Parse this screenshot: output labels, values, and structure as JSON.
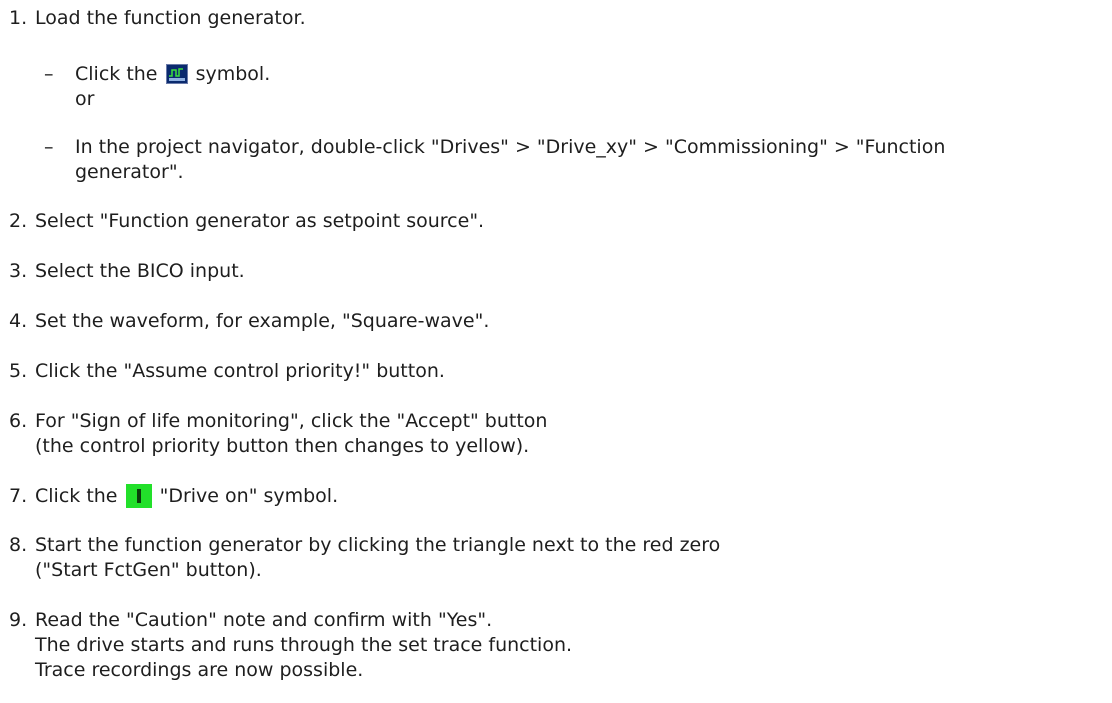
{
  "steps": [
    {
      "num": "1.",
      "text": "Load the function generator."
    },
    {
      "num": "2.",
      "text": "Select \"Function generator as setpoint source\"."
    },
    {
      "num": "3.",
      "text": "Select the BICO input."
    },
    {
      "num": "4.",
      "text": "Set the waveform, for example, \"Square-wave\"."
    },
    {
      "num": "5.",
      "text": "Click the \"Assume control priority!\" button."
    },
    {
      "num": "6.",
      "text": "For \"Sign of life monitoring\", click the \"Accept\" button",
      "text2": "(the control priority button then changes to yellow)."
    },
    {
      "num": "7.",
      "pre": "Click the",
      "post": "\"Drive on\" symbol.",
      "icon": "drive-on-icon"
    },
    {
      "num": "8.",
      "text": "Start the function generator by clicking the triangle next to the red zero",
      "text2": "(\"Start FctGen\" button)."
    },
    {
      "num": "9.",
      "text": "Read the \"Caution\" note and confirm with \"Yes\".",
      "text2": "The drive starts and runs through the set trace function.",
      "text3": "Trace recordings are now possible."
    }
  ],
  "substeps": [
    {
      "dash": "–",
      "pre": "Click the",
      "post": "symbol.",
      "icon": "function-generator-icon",
      "after": "or"
    },
    {
      "dash": "–",
      "text": "In the project navigator, double-click \"Drives\" > \"Drive_xy\" > \"Commissioning\" > \"Function",
      "text2": "generator\"."
    }
  ],
  "colors": {
    "text": "#1e1e1e",
    "drive_on_icon": "#22e02a",
    "function_generator_icon": "#0a2a6e"
  }
}
